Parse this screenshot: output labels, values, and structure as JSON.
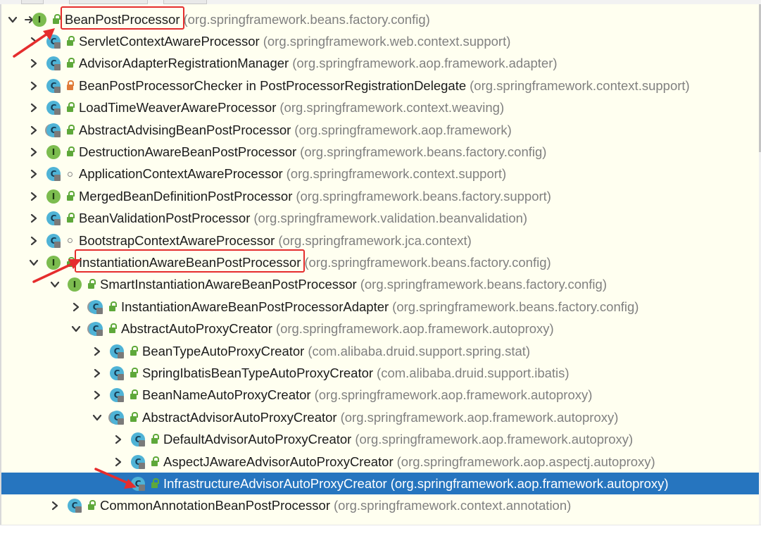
{
  "tree": {
    "rows": [
      {
        "name": "BeanPostProcessor",
        "pkg": "(org.springframework.beans.factory.config)",
        "kind": "interface",
        "vis": "public",
        "depth": 0,
        "state": "focus",
        "highlighted": true
      },
      {
        "name": "ServletContextAwareProcessor",
        "pkg": "(org.springframework.web.context.support)",
        "kind": "class",
        "vis": "public",
        "depth": 1,
        "state": "collapsed"
      },
      {
        "name": "AdvisorAdapterRegistrationManager",
        "pkg": "(org.springframework.aop.framework.adapter)",
        "kind": "class",
        "vis": "public",
        "depth": 1,
        "state": "collapsed"
      },
      {
        "name": "BeanPostProcessorChecker in PostProcessorRegistrationDelegate",
        "pkg": "(org.springframework.context.support)",
        "kind": "class",
        "vis": "private",
        "depth": 1,
        "state": "collapsed"
      },
      {
        "name": "LoadTimeWeaverAwareProcessor",
        "pkg": "(org.springframework.context.weaving)",
        "kind": "class",
        "vis": "public",
        "depth": 1,
        "state": "collapsed"
      },
      {
        "name": "AbstractAdvisingBeanPostProcessor",
        "pkg": "(org.springframework.aop.framework)",
        "kind": "abstract",
        "vis": "public",
        "depth": 1,
        "state": "collapsed"
      },
      {
        "name": "DestructionAwareBeanPostProcessor",
        "pkg": "(org.springframework.beans.factory.config)",
        "kind": "interface",
        "vis": "public",
        "depth": 1,
        "state": "collapsed"
      },
      {
        "name": "ApplicationContextAwareProcessor",
        "pkg": "(org.springframework.context.support)",
        "kind": "class",
        "vis": "package",
        "depth": 1,
        "state": "collapsed"
      },
      {
        "name": "MergedBeanDefinitionPostProcessor",
        "pkg": "(org.springframework.beans.factory.support)",
        "kind": "interface",
        "vis": "public",
        "depth": 1,
        "state": "collapsed"
      },
      {
        "name": "BeanValidationPostProcessor",
        "pkg": "(org.springframework.validation.beanvalidation)",
        "kind": "class",
        "vis": "public",
        "depth": 1,
        "state": "collapsed"
      },
      {
        "name": "BootstrapContextAwareProcessor",
        "pkg": "(org.springframework.jca.context)",
        "kind": "class",
        "vis": "package",
        "depth": 1,
        "state": "collapsed"
      },
      {
        "name": "InstantiationAwareBeanPostProcessor",
        "pkg": "(org.springframework.beans.factory.config)",
        "kind": "interface",
        "vis": "public",
        "depth": 1,
        "state": "expanded",
        "highlighted": true
      },
      {
        "name": "SmartInstantiationAwareBeanPostProcessor",
        "pkg": "(org.springframework.beans.factory.config)",
        "kind": "interface",
        "vis": "public",
        "depth": 2,
        "state": "expanded"
      },
      {
        "name": "InstantiationAwareBeanPostProcessorAdapter",
        "pkg": "(org.springframework.beans.factory.config)",
        "kind": "abstract",
        "vis": "public",
        "depth": 3,
        "state": "collapsed"
      },
      {
        "name": "AbstractAutoProxyCreator",
        "pkg": "(org.springframework.aop.framework.autoproxy)",
        "kind": "abstract",
        "vis": "public",
        "depth": 3,
        "state": "expanded"
      },
      {
        "name": "BeanTypeAutoProxyCreator",
        "pkg": "(com.alibaba.druid.support.spring.stat)",
        "kind": "class",
        "vis": "public",
        "depth": 4,
        "state": "collapsed"
      },
      {
        "name": "SpringIbatisBeanTypeAutoProxyCreator",
        "pkg": "(com.alibaba.druid.support.ibatis)",
        "kind": "class",
        "vis": "public",
        "depth": 4,
        "state": "collapsed"
      },
      {
        "name": "BeanNameAutoProxyCreator",
        "pkg": "(org.springframework.aop.framework.autoproxy)",
        "kind": "class",
        "vis": "public",
        "depth": 4,
        "state": "collapsed"
      },
      {
        "name": "AbstractAdvisorAutoProxyCreator",
        "pkg": "(org.springframework.aop.framework.autoproxy)",
        "kind": "abstract",
        "vis": "public",
        "depth": 4,
        "state": "expanded"
      },
      {
        "name": "DefaultAdvisorAutoProxyCreator",
        "pkg": "(org.springframework.aop.framework.autoproxy)",
        "kind": "class",
        "vis": "public",
        "depth": 5,
        "state": "collapsed"
      },
      {
        "name": "AspectJAwareAdvisorAutoProxyCreator",
        "pkg": "(org.springframework.aop.aspectj.autoproxy)",
        "kind": "class",
        "vis": "public",
        "depth": 5,
        "state": "collapsed"
      },
      {
        "name": "InfrastructureAdvisorAutoProxyCreator",
        "pkg": "(org.springframework.aop.framework.autoproxy)",
        "kind": "class",
        "vis": "public",
        "depth": 5,
        "state": "leaf",
        "selected": true
      },
      {
        "name": "CommonAnnotationBeanPostProcessor",
        "pkg": "(org.springframework.context.annotation)",
        "kind": "class",
        "vis": "public",
        "depth": 2,
        "state": "collapsed"
      }
    ]
  },
  "icons": {
    "class_letter": "C",
    "interface_letter": "I",
    "chevron_collapsed": "chevron-right-icon",
    "chevron_expanded": "chevron-down-icon",
    "focus_marker": "arrow-right-icon"
  },
  "colors": {
    "panel_bg": "#fffff0",
    "selection": "#2675bf",
    "package_text": "#808080",
    "annotation_red": "#e52d2d",
    "class_badge": "#4fb3d6",
    "interface_badge": "#7cbc4f"
  }
}
